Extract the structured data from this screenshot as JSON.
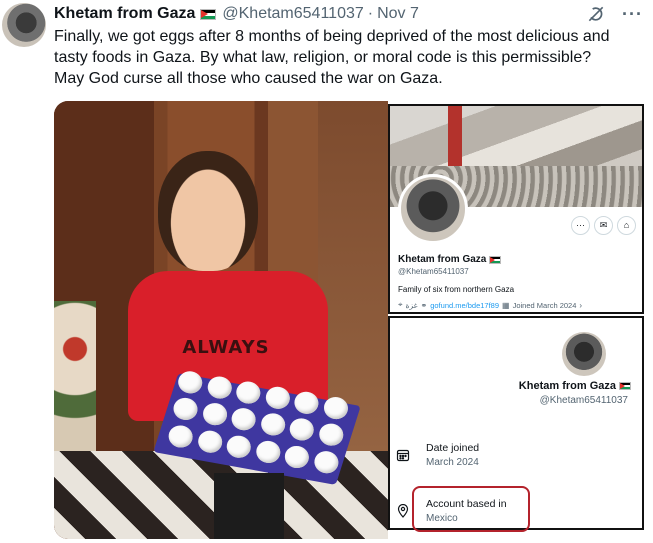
{
  "tweet": {
    "author_name": "Khetam from Gaza",
    "handle": "@Khetam65411037",
    "separator": "·",
    "date": "Nov 7",
    "text": "Finally, we got eggs after 8 months of being deprived of the most delicious and tasty foods in Gaza. By what law, religion, or moral code is this permissible? May God curse all those who caused the war on Gaza.",
    "icons": {
      "grok": "grok-icon",
      "more": "more-icon"
    }
  },
  "photo": {
    "shirt_text": "ALWAYS"
  },
  "profile_card": {
    "name": "Khetam from Gaza",
    "handle": "@Khetam65411037",
    "bio": "Family of six from northern Gaza",
    "location": "غزة",
    "link": "gofund.me/bde17f89",
    "joined": "Joined March 2024",
    "buttons": [
      "more",
      "message",
      "subscribe"
    ]
  },
  "about_card": {
    "name": "Khetam from Gaza",
    "handle": "@Khetam65411037",
    "date_joined_label": "Date joined",
    "date_joined_value": "March 2024",
    "account_based_label": "Account based in",
    "account_based_value": "Mexico"
  },
  "colors": {
    "highlight": "#b4232c",
    "link": "#1d9bf0",
    "muted": "#536471"
  }
}
